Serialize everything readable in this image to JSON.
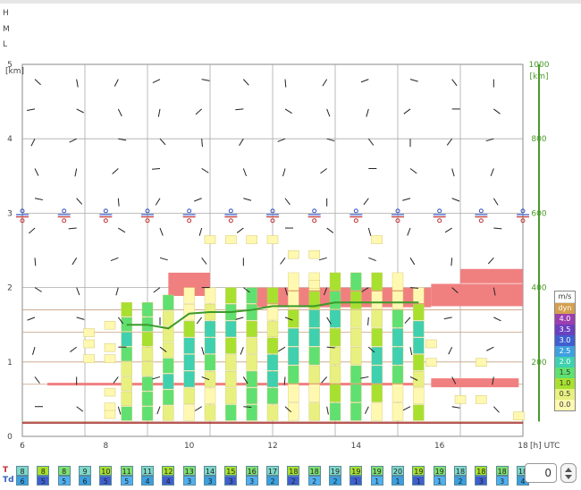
{
  "cloud_levels": [
    "H",
    "M",
    "L"
  ],
  "chart_data": {
    "type": "meteogram",
    "xlabel": "[h] UTC",
    "x_ticks": [
      6,
      8,
      10,
      12,
      14,
      16,
      18
    ],
    "xlim": [
      6,
      18
    ],
    "ylabel_left": "[km]",
    "y_ticks_left": [
      0,
      1,
      2,
      3,
      4,
      5
    ],
    "ylim_left": [
      0,
      5
    ],
    "ylabel_right": "[km]",
    "y_ticks_right": [
      200,
      400,
      600,
      800,
      1000
    ],
    "legend_title": "m/s",
    "legend": [
      {
        "label": "dyn",
        "color": "#d4a050"
      },
      {
        "label": "4.0",
        "color": "#9b3fb0"
      },
      {
        "label": "3.5",
        "color": "#6a3fc0"
      },
      {
        "label": "3.0",
        "color": "#3f5fd0"
      },
      {
        "label": "2.5",
        "color": "#3fa0e0"
      },
      {
        "label": "2.0",
        "color": "#3fd0b0"
      },
      {
        "label": "1.5",
        "color": "#60e070"
      },
      {
        "label": "1.0",
        "color": "#a8e030"
      },
      {
        "label": "0.5",
        "color": "#e8f080"
      },
      {
        "label": "0.0",
        "color": "#fff8b0"
      }
    ],
    "thermal_top_km": [
      {
        "x": 8.5,
        "y": 1.5
      },
      {
        "x": 9.0,
        "y": 1.5
      },
      {
        "x": 9.5,
        "y": 1.45
      },
      {
        "x": 10.0,
        "y": 1.65
      },
      {
        "x": 10.5,
        "y": 1.67
      },
      {
        "x": 11.0,
        "y": 1.67
      },
      {
        "x": 11.5,
        "y": 1.7
      },
      {
        "x": 12.0,
        "y": 1.75
      },
      {
        "x": 12.5,
        "y": 1.75
      },
      {
        "x": 13.0,
        "y": 1.75
      },
      {
        "x": 13.5,
        "y": 1.8
      },
      {
        "x": 14.0,
        "y": 1.8
      },
      {
        "x": 14.5,
        "y": 1.8
      },
      {
        "x": 15.0,
        "y": 1.8
      },
      {
        "x": 15.5,
        "y": 1.8
      }
    ],
    "updraft_columns": [
      {
        "x": 8.5,
        "top": 1.8
      },
      {
        "x": 9.0,
        "top": 1.8
      },
      {
        "x": 9.5,
        "top": 1.9
      },
      {
        "x": 10.0,
        "top": 2.0
      },
      {
        "x": 10.5,
        "top": 2.0
      },
      {
        "x": 11.0,
        "top": 2.0
      },
      {
        "x": 11.5,
        "top": 2.0
      },
      {
        "x": 12.0,
        "top": 2.0
      },
      {
        "x": 12.5,
        "top": 2.2
      },
      {
        "x": 13.0,
        "top": 2.2
      },
      {
        "x": 13.5,
        "top": 2.2
      },
      {
        "x": 14.0,
        "top": 2.2
      },
      {
        "x": 14.5,
        "top": 2.2
      },
      {
        "x": 15.0,
        "top": 2.2
      },
      {
        "x": 15.5,
        "top": 2.0
      }
    ],
    "temperature_row": [
      {
        "label": "T",
        "color": "#c03030",
        "values": [
          "8",
          "8",
          "8",
          "9",
          "10",
          "11",
          "11",
          "12",
          "13",
          "14",
          "15",
          "16",
          "17",
          "18",
          "18",
          "19",
          "19",
          "19",
          "20",
          "19",
          "19",
          "18",
          "18",
          "18",
          "18"
        ]
      },
      {
        "label": "Td",
        "color": "#3060c0",
        "values": [
          "6",
          "5",
          "5",
          "6",
          "5",
          "5",
          "4",
          "4",
          "3",
          "3",
          "3",
          "3",
          "2",
          "2",
          "2",
          "2",
          "1",
          "1",
          "1",
          "1",
          "1",
          "2",
          "3",
          "3",
          "4"
        ]
      }
    ]
  },
  "spinner": {
    "value": "0"
  }
}
